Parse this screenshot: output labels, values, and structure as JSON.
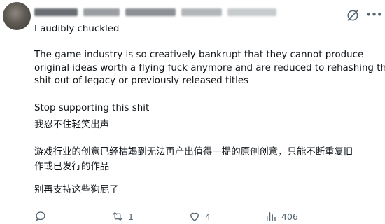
{
  "tweet": {
    "author_display_name": "",
    "author_handle": "",
    "lines": [
      "I audibly chuckled",
      "The game industry is so creatively bankrupt that they cannot produce",
      "original ideas worth a flying fuck anymore and are reduced to rehashing the",
      "shit out of legacy or previously released titles",
      "Stop supporting this shit",
      "我忍不住轻笑出声",
      "游戏行业的创意已经枯竭到无法再产出值得一提的原创创意，只能不断重复旧",
      "作或已发行的作品",
      "别再支持这些狗屁了"
    ]
  },
  "icons": {
    "grok": "grok-icon",
    "more": "more-icon",
    "reply": "reply-icon",
    "retweet": "retweet-icon",
    "like": "like-icon",
    "views": "views-icon"
  },
  "actions": {
    "reply_count": "",
    "retweet_count": "1",
    "like_count": "4",
    "view_count": "406"
  },
  "colors": {
    "text": "#0f1419",
    "secondary": "#536471",
    "background": "#ffffff"
  }
}
